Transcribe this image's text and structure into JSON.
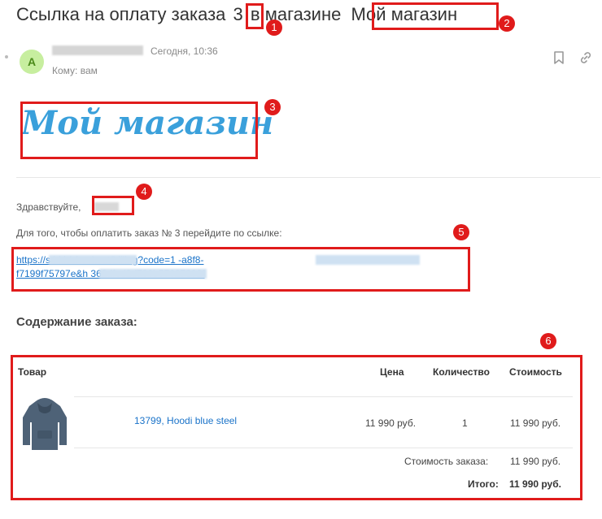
{
  "subject": {
    "part1": "Ссылка на оплату заказа",
    "order_number": "3",
    "part2": "в магазине",
    "store_name": "Мой магазин"
  },
  "sender": {
    "avatar_letter": "A",
    "time": "Сегодня, 10:36",
    "to": "Кому: вам"
  },
  "logo_text": "Мой магазин",
  "body": {
    "greeting": "Здравствуйте,",
    "instruction": "Для того, чтобы оплатить заказ № 3 перейдите по ссылке:",
    "link_line1": "https://s4                         kk/checkout/billing?code=1                                    -a8f8-",
    "link_line2": "f7199f75797e&h                           362dfed2d790b57627382f"
  },
  "order": {
    "title": "Содержание заказа:",
    "columns": [
      "Товар",
      "Цена",
      "Количество",
      "Стоимость"
    ],
    "items": [
      {
        "name": "13799, Hoodi blue steel",
        "price": "11 990 руб.",
        "qty": "1",
        "total": "11 990 руб."
      }
    ],
    "order_cost_label": "Стоимость заказа:",
    "order_cost": "11 990 руб.",
    "total_label": "Итого:",
    "total": "11 990 руб."
  },
  "annotations": [
    "1",
    "2",
    "3",
    "4",
    "5",
    "6"
  ],
  "colors": {
    "highlight": "#e01b1b",
    "link": "#1a73c9",
    "logo": "#3aa0db",
    "avatar_bg": "#c7ee9f"
  }
}
